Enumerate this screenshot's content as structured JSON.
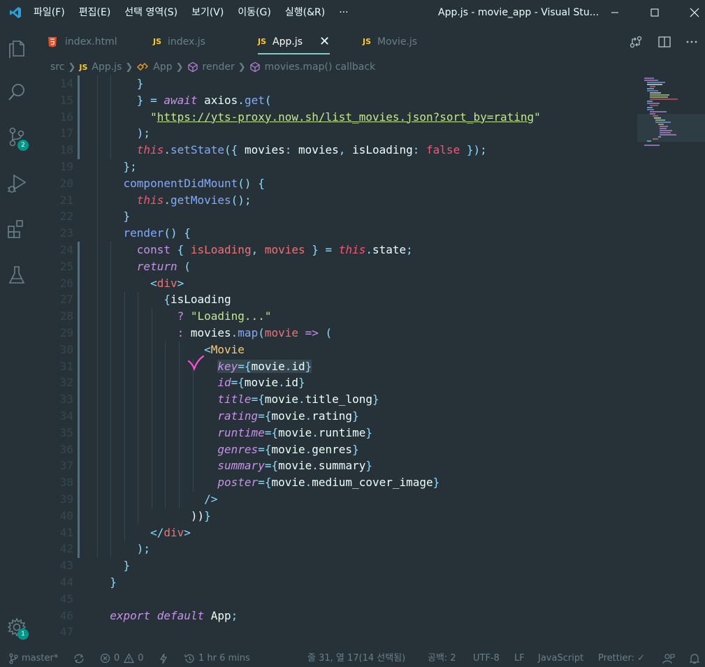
{
  "titlebar": {
    "menus": [
      "파일(F)",
      "편집(E)",
      "선택 영역(S)",
      "보기(V)",
      "이동(G)",
      "실행(&R)",
      "···"
    ],
    "title": "App.js - movie_app - Visual Stu..."
  },
  "activity": {
    "source_control_badge": "2",
    "settings_badge": "1"
  },
  "tabs": [
    {
      "label": "index.html",
      "icon": "html5-icon"
    },
    {
      "label": "index.js",
      "icon": "js-icon"
    },
    {
      "label": "App.js",
      "icon": "js-icon",
      "active": true
    },
    {
      "label": "Movie.js",
      "icon": "js-icon"
    }
  ],
  "tab_badge": "JS",
  "breadcrumb": {
    "folder": "src",
    "file": "App.js",
    "class": "App",
    "method": "render",
    "callback": "movies.map() callback"
  },
  "editor": {
    "line_numbers": [
      "14",
      "15",
      "16",
      "17",
      "18",
      "19",
      "20",
      "21",
      "22",
      "23",
      "24",
      "25",
      "26",
      "27",
      "28",
      "29",
      "30",
      "31",
      "32",
      "33",
      "34",
      "35",
      "36",
      "37",
      "38",
      "39",
      "40",
      "41",
      "42",
      "43",
      "44",
      "45",
      "46",
      "47"
    ],
    "code_lines": [
      "      }",
      "      } = await axios.get(",
      "        \"https://yts-proxy.now.sh/list_movies.json?sort_by=rating\"",
      "      );",
      "      this.setState({ movies: movies, isLoading: false });",
      "    };",
      "    componentDidMount() {",
      "      this.getMovies();",
      "    }",
      "    render() {",
      "      const { isLoading, movies } = this.state;",
      "      return (",
      "        <div>",
      "          {isLoading",
      "            ? \"Loading...\"",
      "            : movies.map(movie => (",
      "                <Movie",
      "                  key={movie.id}",
      "                  id={movie.id}",
      "                  title={movie.title_long}",
      "                  rating={movie.rating}",
      "                  runtime={movie.runtime}",
      "                  genres={movie.genres}",
      "                  summary={movie.summary}",
      "                  poster={movie.medium_cover_image}",
      "                />",
      "              ))}",
      "        </div>",
      "      );",
      "    }",
      "  }",
      "",
      "  export default App;",
      ""
    ]
  },
  "statusbar": {
    "branch": "master*",
    "errors": "0",
    "warnings": "0",
    "time": "1 hr 6 mins",
    "cursor": "줄 31, 열 17(14 선택됨)",
    "indent": "공백: 2",
    "encoding": "UTF-8",
    "eol": "LF",
    "language": "JavaScript",
    "prettier": "Prettier: ✓"
  },
  "colors": {
    "background": "#263238",
    "keyword": "#c792ea",
    "this": "#ff5370",
    "function": "#82aaff",
    "string": "#c3e88d",
    "tag": "#f07178",
    "component": "#ffcb6b",
    "punctuation": "#89ddff",
    "annotation": "#ff4fd8"
  }
}
